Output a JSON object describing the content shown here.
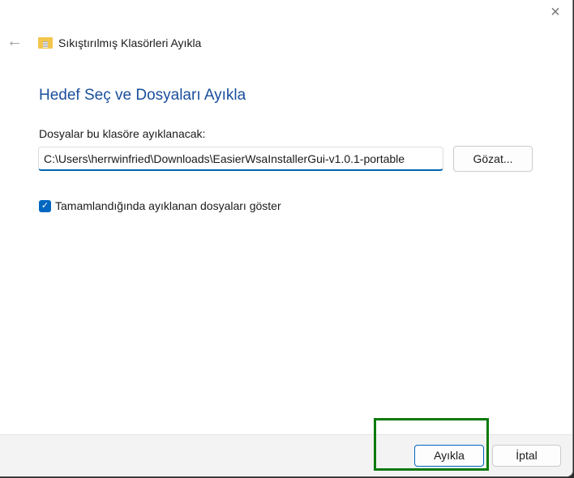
{
  "window": {
    "title": "Sıkıştırılmış Klasörleri Ayıkla",
    "close_icon": "×",
    "back_icon": "←"
  },
  "main": {
    "heading": "Hedef Seç ve Dosyaları Ayıkla",
    "path_label": "Dosyalar bu klasöre ayıklanacak:",
    "path_value": "C:\\Users\\herrwinfried\\Downloads\\EasierWsaInstallerGui-v1.0.1-portable",
    "browse_label": "Gözat...",
    "show_files_label": "Tamamlandığında ayıklanan dosyaları göster",
    "show_files_checked": true,
    "check_glyph": "✓"
  },
  "footer": {
    "extract_label": "Ayıkla",
    "cancel_label": "İptal"
  }
}
